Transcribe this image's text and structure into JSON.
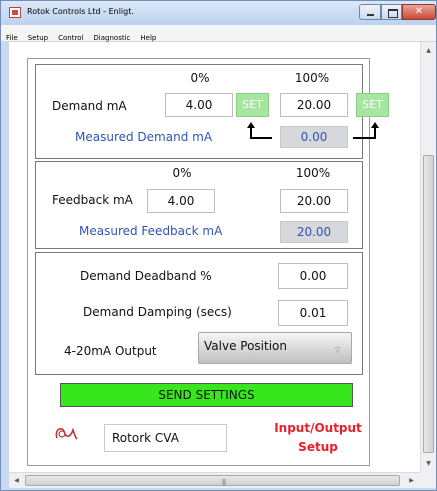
{
  "window": {
    "title": "Rotok Controls Ltd - Enligt."
  },
  "menu": [
    "File",
    "Setup",
    "Control",
    "Diagnostic",
    "Help"
  ],
  "demand": {
    "pct_low": "0%",
    "pct_high": "100%",
    "label": "Demand mA",
    "low_value": "4.00",
    "high_value": "20.00",
    "set_label": "SET",
    "measured_label": "Measured Demand mA",
    "measured_value": "0.00"
  },
  "feedback": {
    "pct_low": "0%",
    "pct_high": "100%",
    "label": "Feedback mA",
    "low_value": "4.00",
    "high_value": "20.00",
    "measured_label": "Measured Feedback mA",
    "measured_value": "20.00"
  },
  "settings": {
    "deadband_label": "Demand Deadband %",
    "deadband_value": "0.00",
    "damping_label": "Demand Damping (secs)",
    "damping_value": "0.01",
    "output_label": "4-20mA Output",
    "output_selected": "Valve Position"
  },
  "send_label": "SEND SETTINGS",
  "footer": {
    "device_name": "Rotork CVA",
    "page_title_line1": "Input/Output",
    "page_title_line2": "Setup"
  },
  "colors": {
    "send_green": "#37e61d",
    "set_green": "#a6e6a0",
    "accent_blue": "#2f55b8",
    "title_red": "#e8202a"
  }
}
